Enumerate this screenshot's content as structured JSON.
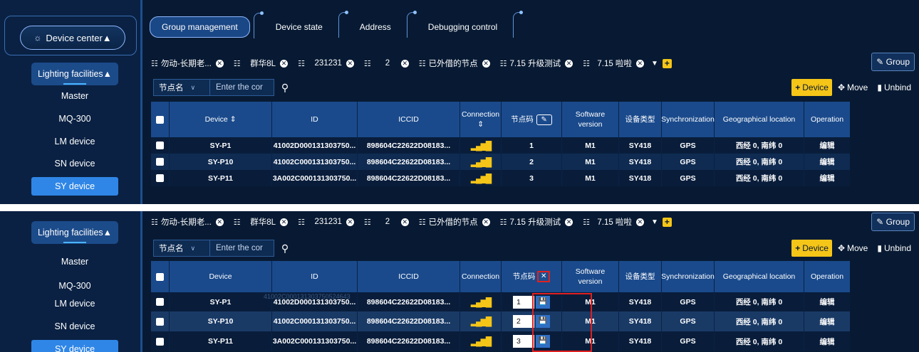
{
  "sidebar": {
    "device_center": "Device center▲",
    "device_center_icon": "led-icon",
    "lighting_facilities": "Lighting facilities▲",
    "items": [
      "Master",
      "MQ-300",
      "LM device",
      "SN device",
      "SY device"
    ],
    "active_item": "SY device"
  },
  "top_tabs": [
    "Group management",
    "Device state",
    "Address",
    "Debugging control"
  ],
  "group_tabs": [
    "勿动-长期老...",
    "群华8L",
    "231231",
    "2",
    "已外借的节点",
    "7.15 升级测试",
    "7.15 啦啦"
  ],
  "group_button": "Group",
  "search": {
    "select_value": "节点名",
    "placeholder": "Enter the cor"
  },
  "actions": {
    "add_device": "Device",
    "move": "Move",
    "unbind": "Unbind"
  },
  "table1": {
    "headers": [
      "Device",
      "ID",
      "ICCID",
      "Connection",
      "节点码",
      "Software version",
      "设备类型",
      "Synchronization",
      "Geographical location",
      "Operation"
    ]
  },
  "table2": {
    "headers": [
      "Device",
      "ID",
      "ICCID",
      "Connection",
      "节点码",
      "Software version",
      "设备类型",
      "Synchronization",
      "Geographical location",
      "Operation"
    ]
  },
  "rows": [
    {
      "device": "SY-P1",
      "id": "41002D000131303750...",
      "iccid": "898604C22622D08183...",
      "code": "1",
      "software": "M1",
      "type": "SY418",
      "sync": "GPS",
      "location": "西经 0, 南纬 0",
      "operation": "编辑"
    },
    {
      "device": "SY-P10",
      "id": "41002C000131303750...",
      "iccid": "898604C22622D08183...",
      "code": "2",
      "software": "M1",
      "type": "SY418",
      "sync": "GPS",
      "location": "西经 0, 南纬 0",
      "operation": "编辑"
    },
    {
      "device": "SY-P11",
      "id": "3A002C000131303750...",
      "iccid": "898604C22622D08183...",
      "code": "3",
      "software": "M1",
      "type": "SY418",
      "sync": "GPS",
      "location": "西经 0, 南纬 0",
      "operation": "编辑"
    }
  ],
  "ghost_tooltip": "41002C000131303750524643",
  "colors": {
    "background": "#081a33",
    "header": "#1a4a8c",
    "accent_yellow": "#f5c518",
    "highlight_red": "#e02020",
    "active_blue": "#2f86e6"
  }
}
